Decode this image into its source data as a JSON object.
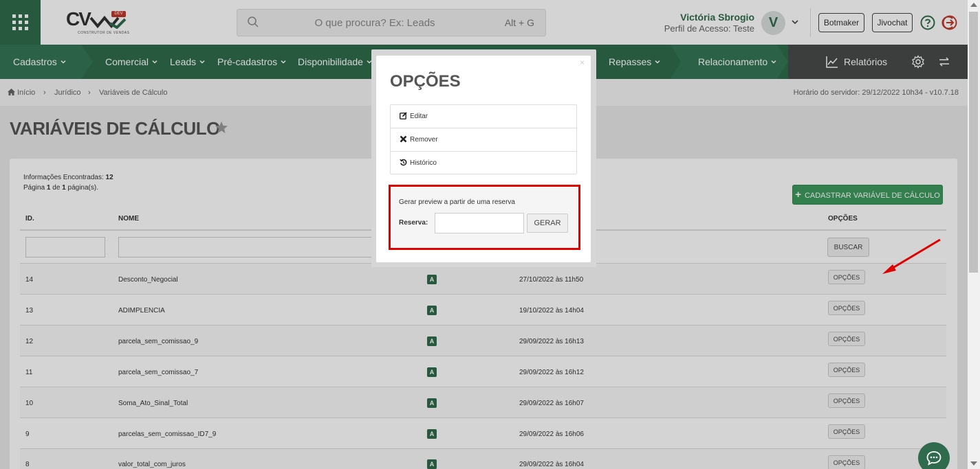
{
  "header": {
    "logo_text": "CV",
    "logo_badge": "DEV",
    "logo_subtitle": "CONSTRUTOR DE VENDAS",
    "search_placeholder": "O que procura? Ex: Leads",
    "search_shortcut": "Alt + G",
    "user_name": "Victória Sbrogio",
    "user_profile": "Perfil de Acesso: Teste",
    "avatar_initial": "V",
    "botmaker_label": "Botmaker",
    "jivochat_label": "Jivochat"
  },
  "nav": {
    "items": [
      "Cadastros",
      "Comercial",
      "Leads",
      "Pré-cadastros",
      "Disponibilidade",
      "Repasses",
      "Relacionamento"
    ],
    "reports_label": "Relatórios",
    "color": "#2f6b4c"
  },
  "breadcrumb": {
    "items": [
      "Início",
      "Jurídico",
      "Variáveis de Cálculo"
    ],
    "server_time": "Horário do servidor: 29/12/2022 10h34 - v10.7.18"
  },
  "page": {
    "title": "VARIÁVEIS DE CÁLCULO",
    "info_found_label": "Informações Encontradas:",
    "info_found_count": "12",
    "page_info_prefix": "Página",
    "page_current": "1",
    "page_info_mid": "de",
    "page_total": "1",
    "page_info_suffix": "página(s).",
    "add_button": "CADASTRAR VARIÁVEL DE CÁLCULO",
    "buscar_label": "BUSCAR"
  },
  "table": {
    "headers": {
      "id": "ID.",
      "nome": "NOME",
      "opcoes": "OPÇÕES"
    },
    "rows": [
      {
        "id": "14",
        "nome": "Desconto_Negocial",
        "status": "A",
        "date": "27/10/2022 às 11h50",
        "opt": "OPÇÕES"
      },
      {
        "id": "13",
        "nome": "ADIMPLENCIA",
        "status": "A",
        "date": "19/10/2022 às 14h04",
        "opt": "OPÇÕES"
      },
      {
        "id": "12",
        "nome": "parcela_sem_comissao_9",
        "status": "A",
        "date": "29/09/2022 às 16h13",
        "opt": "OPÇÕES"
      },
      {
        "id": "11",
        "nome": "parcela_sem_comissao_7",
        "status": "A",
        "date": "29/09/2022 às 16h12",
        "opt": "OPÇÕES"
      },
      {
        "id": "10",
        "nome": "Soma_Ato_Sinal_Total",
        "status": "A",
        "date": "29/09/2022 às 16h07",
        "opt": "OPÇÕES"
      },
      {
        "id": "9",
        "nome": "parcelas_sem_comissao_ID7_9",
        "status": "A",
        "date": "29/09/2022 às 16h06",
        "opt": "OPÇÕES"
      },
      {
        "id": "8",
        "nome": "valor_total_com_juros",
        "status": "A",
        "date": "29/09/2022 às 16h04",
        "opt": "OPÇÕES"
      }
    ]
  },
  "modal": {
    "title": "OPÇÕES",
    "close": "×",
    "options": [
      {
        "label": "Editar",
        "icon": "edit-icon"
      },
      {
        "label": "Remover",
        "icon": "remove-icon"
      },
      {
        "label": "Histórico",
        "icon": "history-icon"
      }
    ],
    "preview_label": "Gerar preview a partir de uma reserva",
    "reserva_label": "Reserva:",
    "reserva_value": "",
    "gerar_label": "GERAR",
    "highlight_color": "#e00000"
  }
}
